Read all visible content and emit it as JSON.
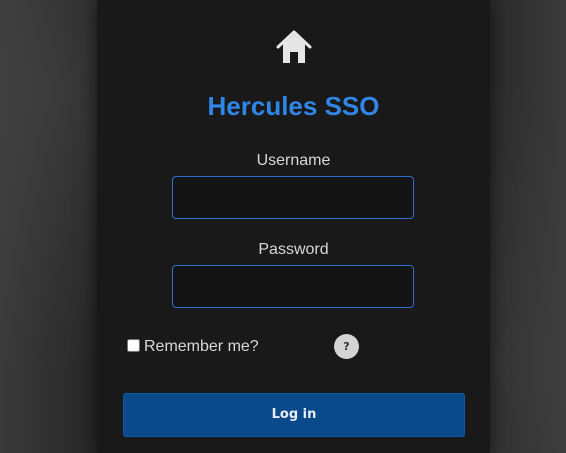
{
  "app": {
    "title": "Hercules SSO",
    "logo_icon": "home-icon"
  },
  "form": {
    "username_label": "Username",
    "username_value": "",
    "password_label": "Password",
    "password_value": "",
    "remember_label": "Remember me?",
    "remember_checked": false,
    "help_label": "?",
    "login_label": "Log in"
  },
  "colors": {
    "accent": "#2f86e6",
    "button": "#0b4a8a",
    "field_border": "#2f6fd1"
  }
}
